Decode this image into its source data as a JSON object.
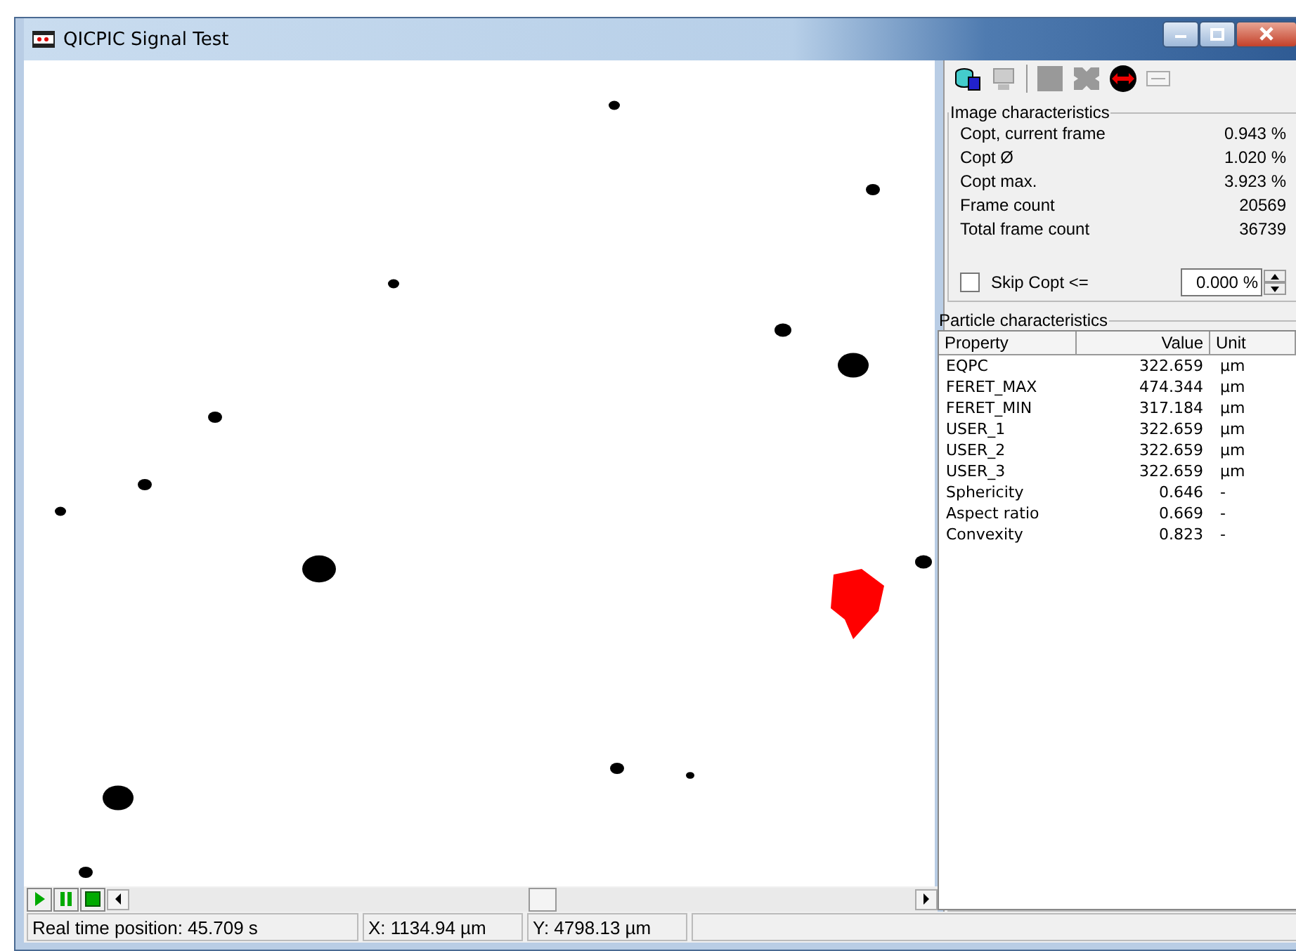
{
  "window": {
    "title": "QICPIC Signal Test"
  },
  "image_characteristics": {
    "title": "Image characteristics",
    "rows": [
      {
        "label": "Copt, current frame",
        "value": "0.943 %"
      },
      {
        "label": "Copt Ø",
        "value": "1.020 %"
      },
      {
        "label": "Copt max.",
        "value": "3.923 %"
      },
      {
        "label": "Frame count",
        "value": "20569"
      },
      {
        "label": "Total frame count",
        "value": "36739"
      }
    ],
    "skip": {
      "label": "Skip Copt <=",
      "checked": false,
      "value": "0.000 %"
    }
  },
  "particle_characteristics": {
    "title": "Particle characteristics",
    "columns": [
      "Property",
      "Value",
      "Unit"
    ],
    "rows": [
      {
        "property": "EQPC",
        "value": "322.659",
        "unit": "µm"
      },
      {
        "property": "FERET_MAX",
        "value": "474.344",
        "unit": "µm"
      },
      {
        "property": "FERET_MIN",
        "value": "317.184",
        "unit": "µm"
      },
      {
        "property": "USER_1",
        "value": "322.659",
        "unit": "µm"
      },
      {
        "property": "USER_2",
        "value": "322.659",
        "unit": "µm"
      },
      {
        "property": "USER_3",
        "value": "322.659",
        "unit": "µm"
      },
      {
        "property": "Sphericity",
        "value": "0.646",
        "unit": "-"
      },
      {
        "property": "Aspect ratio",
        "value": "0.669",
        "unit": "-"
      },
      {
        "property": "Convexity",
        "value": "0.823",
        "unit": "-"
      }
    ]
  },
  "status_bar": [
    "Real time position: 45.709 s",
    "X: 1134.94 µm",
    "Y: 4798.13 µm"
  ]
}
